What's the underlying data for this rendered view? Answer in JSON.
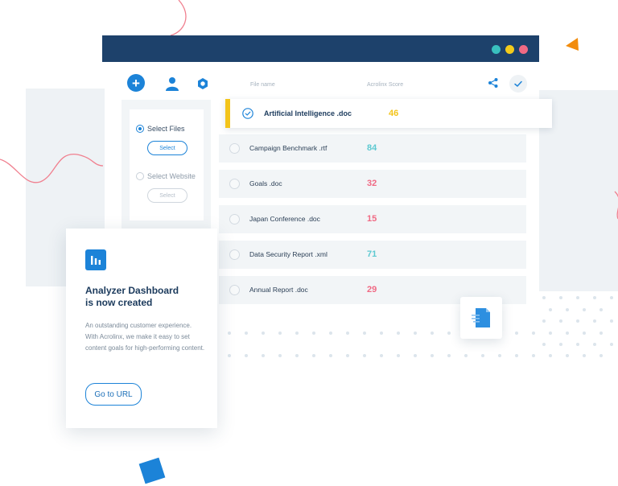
{
  "toolbar": {
    "columns": {
      "file_name": "File name",
      "score": "Acrolinx Score"
    }
  },
  "sidebar": {
    "select_files": {
      "label": "Select Files",
      "button": "Select",
      "checked": true
    },
    "select_website": {
      "label": "Select Website",
      "button": "Select",
      "checked": false
    }
  },
  "files": [
    {
      "name": "Artificial Intelligence .doc",
      "score": "46",
      "color": "#f3c41b",
      "selected": true
    },
    {
      "name": "Campaign Benchmark .rtf",
      "score": "84",
      "color": "#5dc9d1",
      "selected": false
    },
    {
      "name": "Goals .doc",
      "score": "32",
      "color": "#f06a84",
      "selected": false
    },
    {
      "name": "Japan Conference .doc",
      "score": "15",
      "color": "#f06a84",
      "selected": false
    },
    {
      "name": "Data Security Report .xml",
      "score": "71",
      "color": "#5dc9d1",
      "selected": false
    },
    {
      "name": "Annual Report .doc",
      "score": "29",
      "color": "#f06a84",
      "selected": false
    }
  ],
  "card": {
    "title_line1": "Analyzer Dashboard",
    "title_line2": "is now created",
    "description": "An outstanding customer experience.  With Acrolinx, we make it easy to set content goals for high-performing content.",
    "button": "Go to URL"
  },
  "colors": {
    "accent": "#1c83d8",
    "titlebar": "#1d416b",
    "high": "#5dc9d1",
    "mid": "#f3c41b",
    "low": "#f06a84"
  }
}
